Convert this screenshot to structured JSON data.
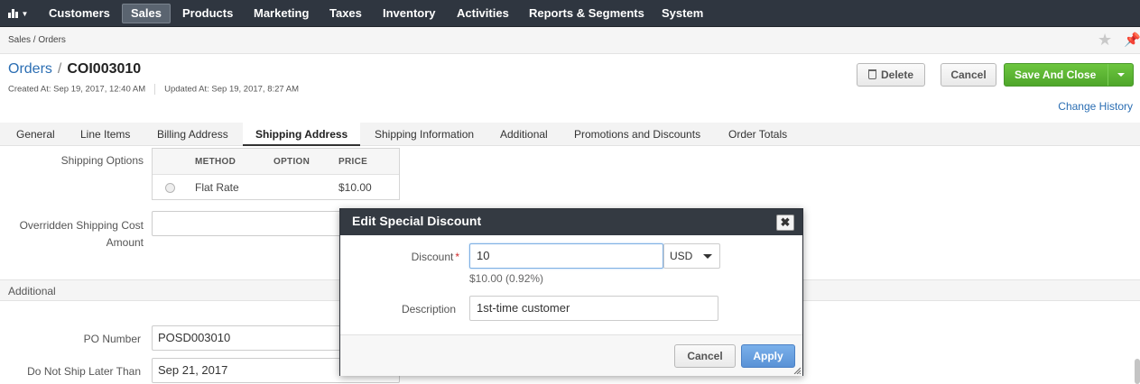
{
  "nav": {
    "dashboard_icon": "bar-chart-icon",
    "items": [
      "Customers",
      "Sales",
      "Products",
      "Marketing",
      "Taxes",
      "Inventory",
      "Activities",
      "Reports & Segments",
      "System"
    ],
    "active": "Sales"
  },
  "breadcrumb": "Sales / Orders",
  "header": {
    "entity_link": "Orders",
    "separator": "/",
    "record_code": "COI003010",
    "created": "Created At: Sep 19, 2017, 12:40 AM",
    "updated": "Updated At: Sep 19, 2017, 8:27 AM"
  },
  "actions": {
    "delete": "Delete",
    "cancel": "Cancel",
    "save_close": "Save And Close",
    "change_history": "Change History"
  },
  "tabs": [
    "General",
    "Line Items",
    "Billing Address",
    "Shipping Address",
    "Shipping Information",
    "Additional",
    "Promotions and Discounts",
    "Order Totals"
  ],
  "active_tab": "Shipping Address",
  "shipping": {
    "label": "Shipping Options",
    "columns": [
      "METHOD",
      "OPTION",
      "PRICE"
    ],
    "rows": [
      {
        "method": "Flat Rate",
        "option": "",
        "price": "$10.00"
      }
    ],
    "overridden_label_line1": "Overridden Shipping Cost",
    "overridden_label_line2": "Amount",
    "overridden_value": ""
  },
  "additional": {
    "section_title": "Additional",
    "po_label": "PO Number",
    "po_value": "POSD003010",
    "ship_label": "Do Not Ship Later Than",
    "ship_value": "Sep 21, 2017"
  },
  "modal": {
    "title": "Edit Special Discount",
    "close_symbol": "✖",
    "discount_label": "Discount",
    "required_mark": "*",
    "discount_value": "10",
    "currency": "USD",
    "discount_hint": "$10.00 (0.92%)",
    "description_label": "Description",
    "description_value": "1st-time customer",
    "cancel": "Cancel",
    "apply": "Apply"
  },
  "colors": {
    "nav_bg": "#2f3640",
    "link": "#2b6eb3",
    "save_green": "#56ae2f",
    "apply_blue": "#5a92d6",
    "modal_header": "#343a42"
  }
}
